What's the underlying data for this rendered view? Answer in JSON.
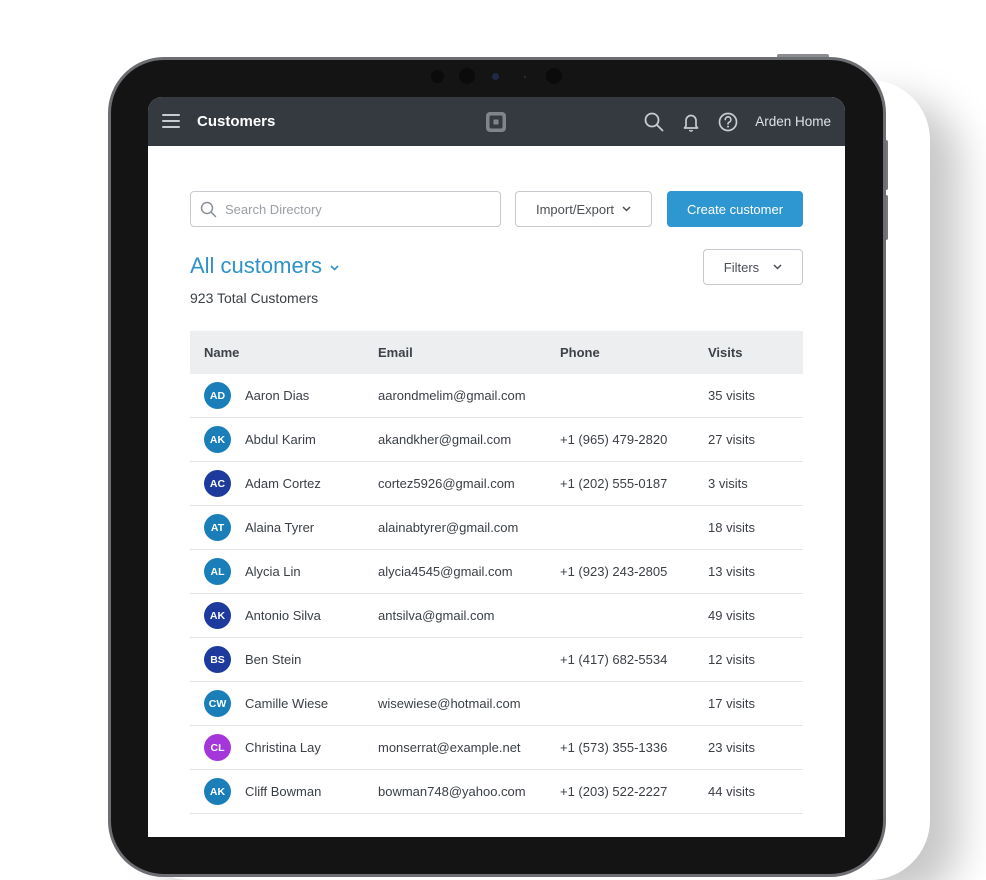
{
  "colors": {
    "topbar": "#353a41",
    "accent": "#2e96d1",
    "title_blue": "#2e92c9",
    "avatar_teal": "#1a7fb8",
    "avatar_navy": "#1d3a9c",
    "avatar_purple": "#a437d9"
  },
  "header": {
    "title": "Customers",
    "logo_icon": "square-logo-icon",
    "icons": [
      "search-icon",
      "bell-icon",
      "help-icon"
    ],
    "account_name": "Arden Home"
  },
  "toolbar": {
    "search_placeholder": "Search Directory",
    "search_value": "",
    "import_export_label": "Import/Export",
    "create_label": "Create customer",
    "filters_label": "Filters"
  },
  "list": {
    "title": "All customers",
    "total_label": "923 Total Customers"
  },
  "table": {
    "columns": [
      "Name",
      "Email",
      "Phone",
      "Visits"
    ],
    "rows": [
      {
        "initials": "AD",
        "avatar_color": "#1a7fb8",
        "name": "Aaron Dias",
        "email": "aarondmelim@gmail.com",
        "phone": "",
        "visits": "35 visits"
      },
      {
        "initials": "AK",
        "avatar_color": "#1a7fb8",
        "name": "Abdul Karim",
        "email": "akandkher@gmail.com",
        "phone": "+1 (965) 479-2820",
        "visits": "27 visits"
      },
      {
        "initials": "AC",
        "avatar_color": "#1d3a9c",
        "name": "Adam Cortez",
        "email": "cortez5926@gmail.com",
        "phone": "+1 (202) 555-0187",
        "visits": "3 visits"
      },
      {
        "initials": "AT",
        "avatar_color": "#1a7fb8",
        "name": "Alaina Tyrer",
        "email": "alainabtyrer@gmail.com",
        "phone": "",
        "visits": "18 visits"
      },
      {
        "initials": "AL",
        "avatar_color": "#1a7fb8",
        "name": "Alycia Lin",
        "email": "alycia4545@gmail.com",
        "phone": "+1 (923) 243-2805",
        "visits": "13 visits"
      },
      {
        "initials": "AK",
        "avatar_color": "#1d3a9c",
        "name": "Antonio Silva",
        "email": "antsilva@gmail.com",
        "phone": "",
        "visits": "49 visits"
      },
      {
        "initials": "BS",
        "avatar_color": "#1d3a9c",
        "name": "Ben Stein",
        "email": "",
        "phone": "+1 (417) 682-5534",
        "visits": "12 visits"
      },
      {
        "initials": "CW",
        "avatar_color": "#1a7fb8",
        "name": "Camille Wiese",
        "email": "wisewiese@hotmail.com",
        "phone": "",
        "visits": "17 visits"
      },
      {
        "initials": "CL",
        "avatar_color": "#a437d9",
        "name": "Christina Lay",
        "email": "monserrat@example.net",
        "phone": "+1 (573) 355-1336",
        "visits": "23 visits"
      },
      {
        "initials": "AK",
        "avatar_color": "#1a7fb8",
        "name": "Cliff Bowman",
        "email": "bowman748@yahoo.com",
        "phone": "+1 (203) 522-2227",
        "visits": "44 visits"
      }
    ]
  }
}
